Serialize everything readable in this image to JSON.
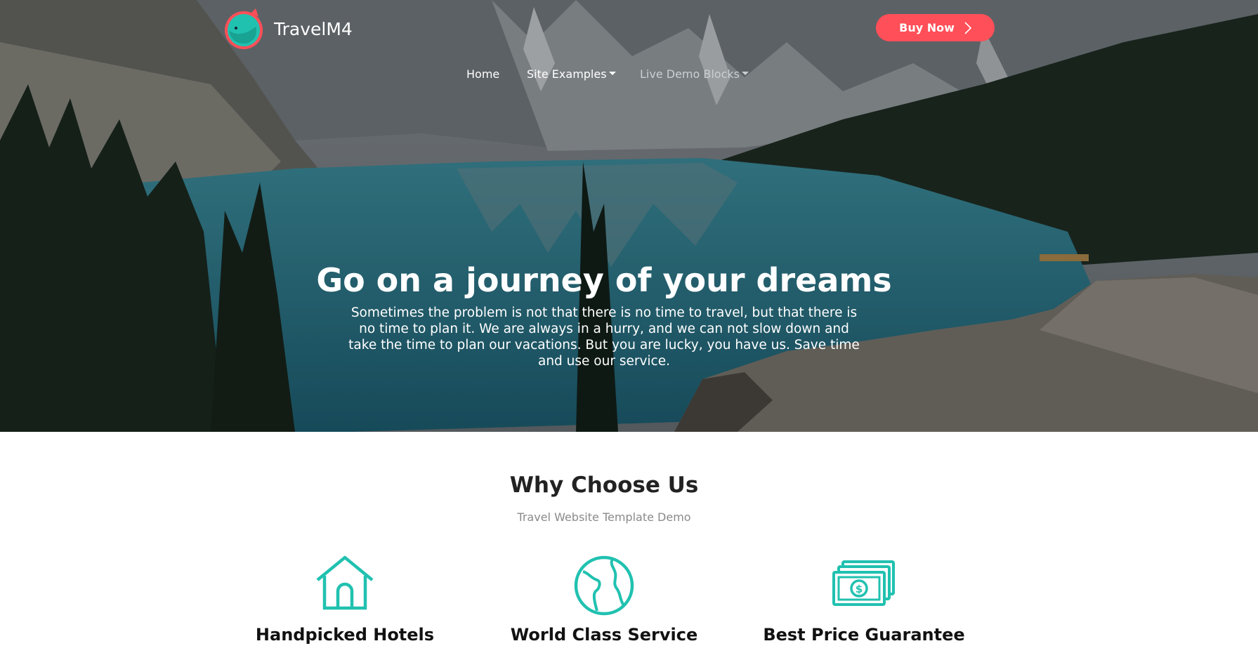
{
  "brand": {
    "name": "TravelM4",
    "logo_icon": "whale-logo-icon",
    "accent": "#ff4f58",
    "teal": "#21c1b0"
  },
  "header": {
    "buy_button": {
      "label": "Buy Now",
      "icon": "chevron-right-icon"
    },
    "nav": [
      {
        "label": "Home",
        "dropdown": false
      },
      {
        "label": "Site Examples",
        "dropdown": true
      },
      {
        "label": "Live Demo Blocks",
        "dropdown": true
      }
    ]
  },
  "hero": {
    "title": "Go on a journey of your dreams",
    "description": "Sometimes the problem is not that there is no time to travel, but that there is no time to plan it. We are always in a hurry, and we can not slow down and take the time to plan our vacations. But you are lucky, you have us. Save time and use our service."
  },
  "why": {
    "title": "Why Choose Us",
    "subtitle": "Travel Website Template Demo",
    "features": [
      {
        "label": "Handpicked Hotels",
        "icon": "house-icon"
      },
      {
        "label": "World Class Service",
        "icon": "globe-icon"
      },
      {
        "label": "Best Price Guarantee",
        "icon": "money-icon"
      }
    ]
  }
}
